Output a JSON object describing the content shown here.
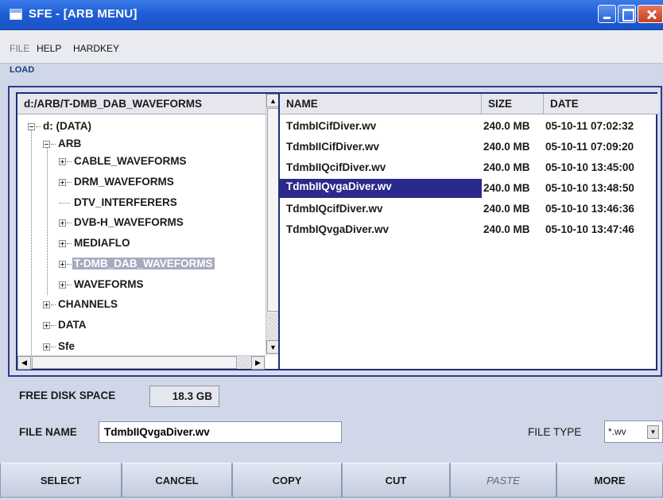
{
  "window": {
    "title": "SFE - [ARB MENU]"
  },
  "menu": {
    "items": [
      "FILE",
      "HELP",
      "HARDKEY"
    ]
  },
  "section_label": "LOAD",
  "tree": {
    "path": "d:/ARB/T-DMB_DAB_WAVEFORMS",
    "items": [
      {
        "label": "d: (DATA)",
        "expanded": true
      },
      {
        "label": "ARB",
        "expanded": true
      },
      {
        "label": "CABLE_WAVEFORMS",
        "expandable": true
      },
      {
        "label": "DRM_WAVEFORMS",
        "expandable": true
      },
      {
        "label": "DTV_INTERFERERS",
        "expandable": false
      },
      {
        "label": "DVB-H_WAVEFORMS",
        "expandable": true
      },
      {
        "label": "MEDIAFLO",
        "expandable": true
      },
      {
        "label": "T-DMB_DAB_WAVEFORMS",
        "expandable": true,
        "selected": true
      },
      {
        "label": "WAVEFORMS",
        "expandable": true
      },
      {
        "label": "CHANNELS",
        "expandable": true
      },
      {
        "label": "DATA",
        "expandable": true
      },
      {
        "label": "Sfe",
        "expandable": true
      }
    ]
  },
  "file_list": {
    "columns": [
      "NAME",
      "SIZE",
      "DATE"
    ],
    "rows": [
      {
        "name": "TdmbICifDiver.wv",
        "size": "240.0 MB",
        "date": "05-10-11 07:02:32"
      },
      {
        "name": "TdmbIICifDiver.wv",
        "size": "240.0 MB",
        "date": "05-10-11 07:09:20"
      },
      {
        "name": "TdmbIIQcifDiver.wv",
        "size": "240.0 MB",
        "date": "05-10-10 13:45:00"
      },
      {
        "name": "TdmbIIQvgaDiver.wv",
        "size": "240.0 MB",
        "date": "05-10-10 13:48:50",
        "selected": true
      },
      {
        "name": "TdmbIQcifDiver.wv",
        "size": "240.0 MB",
        "date": "05-10-10 13:46:36"
      },
      {
        "name": "TdmbIQvgaDiver.wv",
        "size": "240.0 MB",
        "date": "05-10-10 13:47:46"
      }
    ]
  },
  "disk": {
    "label": "FREE DISK SPACE",
    "value": "18.3 GB"
  },
  "file_name": {
    "label": "FILE NAME",
    "value": "TdmbIIQvgaDiver.wv"
  },
  "file_type": {
    "label": "FILE TYPE",
    "value": "*.wv"
  },
  "buttons": {
    "select": "SELECT",
    "cancel": "CANCEL",
    "copy": "COPY",
    "cut": "CUT",
    "paste": "PASTE",
    "more": "MORE"
  },
  "colors": {
    "title_bar": "#1f5fd6",
    "selection": "#2a2a8a",
    "tree_selection": "#a7abc0",
    "frame_border": "#1e2d7a"
  }
}
